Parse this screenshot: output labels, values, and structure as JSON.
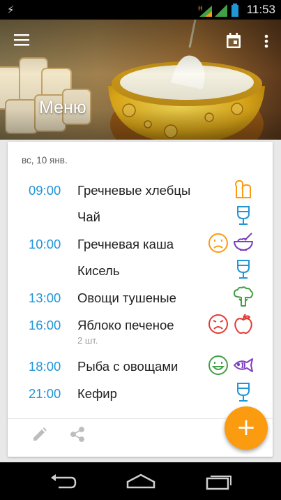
{
  "status_bar": {
    "time": "11:53",
    "network": "H"
  },
  "header": {
    "title": "Меню"
  },
  "colors": {
    "accent": "#fb9b0f",
    "time_blue": "#2196d6",
    "icon_blue": "#2196d6",
    "neutral_face": "#fb9b0f",
    "sad_face": "#e53935",
    "happy_face": "#43a047",
    "fish": "#7b3fbf",
    "broccoli": "#43a047",
    "apple": "#e53935"
  },
  "card": {
    "date": "вс, 10 янв.",
    "entries": [
      {
        "time": "09:00",
        "name": "Гречневые хлебцы",
        "note": "",
        "mood_icon": "",
        "food_icon": "bread-icon"
      },
      {
        "time": "",
        "name": "Чай",
        "note": "",
        "mood_icon": "",
        "food_icon": "glass-icon"
      },
      {
        "time": "10:00",
        "name": "Гречневая каша",
        "note": "",
        "mood_icon": "neutral-face-icon",
        "food_icon": "bowl-icon"
      },
      {
        "time": "",
        "name": "Кисель",
        "note": "",
        "mood_icon": "",
        "food_icon": "glass-icon"
      },
      {
        "time": "13:00",
        "name": "Овощи тушеные",
        "note": "",
        "mood_icon": "",
        "food_icon": "broccoli-icon"
      },
      {
        "time": "16:00",
        "name": "Яблоко печеное",
        "note": "2 шт.",
        "mood_icon": "sad-face-icon",
        "food_icon": "apple-icon"
      },
      {
        "time": "18:00",
        "name": "Рыба с овощами",
        "note": "",
        "mood_icon": "happy-face-icon",
        "food_icon": "fish-icon"
      },
      {
        "time": "21:00",
        "name": "Кефир",
        "note": "",
        "mood_icon": "",
        "food_icon": "glass-icon"
      }
    ],
    "actions": [
      "edit-icon",
      "share-icon"
    ]
  },
  "fab": {
    "label": "+"
  },
  "nav_bar": [
    "back-icon",
    "home-icon",
    "recents-icon"
  ]
}
